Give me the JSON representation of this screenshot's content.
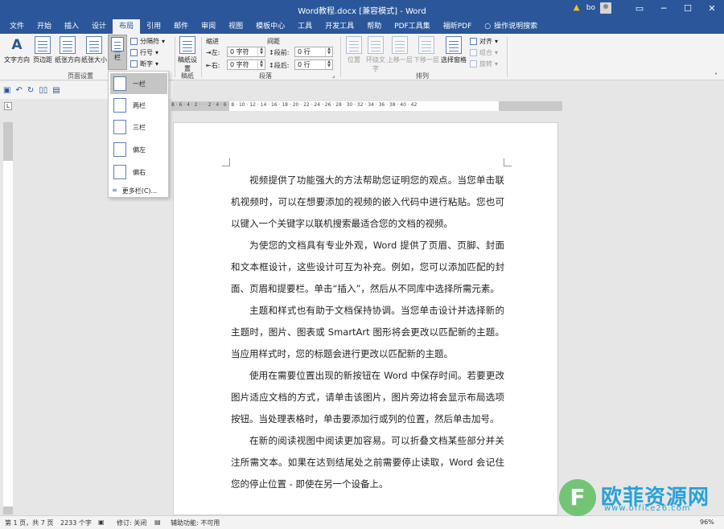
{
  "window": {
    "title": "Word教程.docx [兼容模式] - Word",
    "user": "bo",
    "controls": [
      "▭",
      "─",
      "☐",
      "✕"
    ]
  },
  "tabs": [
    "文件",
    "开始",
    "插入",
    "设计",
    "布局",
    "引用",
    "邮件",
    "审阅",
    "视图",
    "模板中心",
    "工具",
    "开发工具",
    "帮助",
    "PDF工具集",
    "福昕PDF",
    "操作说明搜索"
  ],
  "ribbon": {
    "page_setup": {
      "text_direction": "文字方向",
      "margins": "页边距",
      "orientation": "纸张方向",
      "size": "纸张大小",
      "columns": "栏",
      "breaks": "分隔符",
      "line_numbers": "行号",
      "hyphenation": "断字",
      "group_label": "页面设置"
    },
    "manuscript": {
      "button": "稿纸设置",
      "group_label": "稿纸"
    },
    "paragraph": {
      "indent_title": "缩进",
      "spacing_title": "间距",
      "left_label": "左:",
      "right_label": "右:",
      "left_value": "0 字符",
      "right_value": "0 字符",
      "before_label": "段前:",
      "after_label": "段后:",
      "before_value": "0 行",
      "after_value": "0 行",
      "group_label": "段落"
    },
    "arrange": {
      "position": "位置",
      "wrap": "环绕文字",
      "forward": "上移一层",
      "backward": "下移一层",
      "selection_pane": "选择窗格",
      "align": "对齐",
      "group": "组合",
      "rotate": "旋转",
      "group_label": "排列"
    }
  },
  "columns_menu": {
    "items": [
      "一栏",
      "两栏",
      "三栏",
      "偏左",
      "偏右"
    ],
    "selected": "一栏",
    "more": "更多栏(C)..."
  },
  "ruler": {
    "h_ticks": "8 · 6 · 4 · 2 · · · 2 · 4 · 6 · 8 · 10 · 12 · 14 · 16 · 18 · 20 · 22 · 24 · 26 · 28 · 30 · 32 · 34 · 36 · 38 · 40 · 42"
  },
  "document": {
    "paragraphs": [
      "视频提供了功能强大的方法帮助您证明您的观点。当您单击联机视频时，可以在想要添加的视频的嵌入代码中进行粘贴。您也可以键入一个关键字以联机搜索最适合您的文档的视频。",
      "为使您的文档具有专业外观，Word 提供了页眉、页脚、封面和文本框设计，这些设计可互为补充。例如，您可以添加匹配的封面、页眉和提要栏。单击“插入”，然后从不同库中选择所需元素。",
      "主题和样式也有助于文档保持协调。当您单击设计并选择新的主题时，图片、图表或 SmartArt 图形将会更改以匹配新的主题。当应用样式时，您的标题会进行更改以匹配新的主题。",
      "使用在需要位置出现的新按钮在 Word 中保存时间。若要更改图片适应文档的方式，请单击该图片，图片旁边将会显示布局选项按钮。当处理表格时，单击要添加行或列的位置，然后单击加号。",
      "在新的阅读视图中阅读更加容易。可以折叠文档某些部分并关注所需文本。如果在达到结尾处之前需要停止读取，Word 会记住您的停止位置 - 即使在另一个设备上。"
    ]
  },
  "status": {
    "page": "第 1 页，共 7 页",
    "words": "2233 个字",
    "track": "修订: 关闭",
    "accessibility": "辅助功能: 不可用",
    "zoom": "96%"
  },
  "watermark": {
    "logo_letter": "F",
    "title": "欧菲资源网",
    "url": "www.office26.com"
  }
}
